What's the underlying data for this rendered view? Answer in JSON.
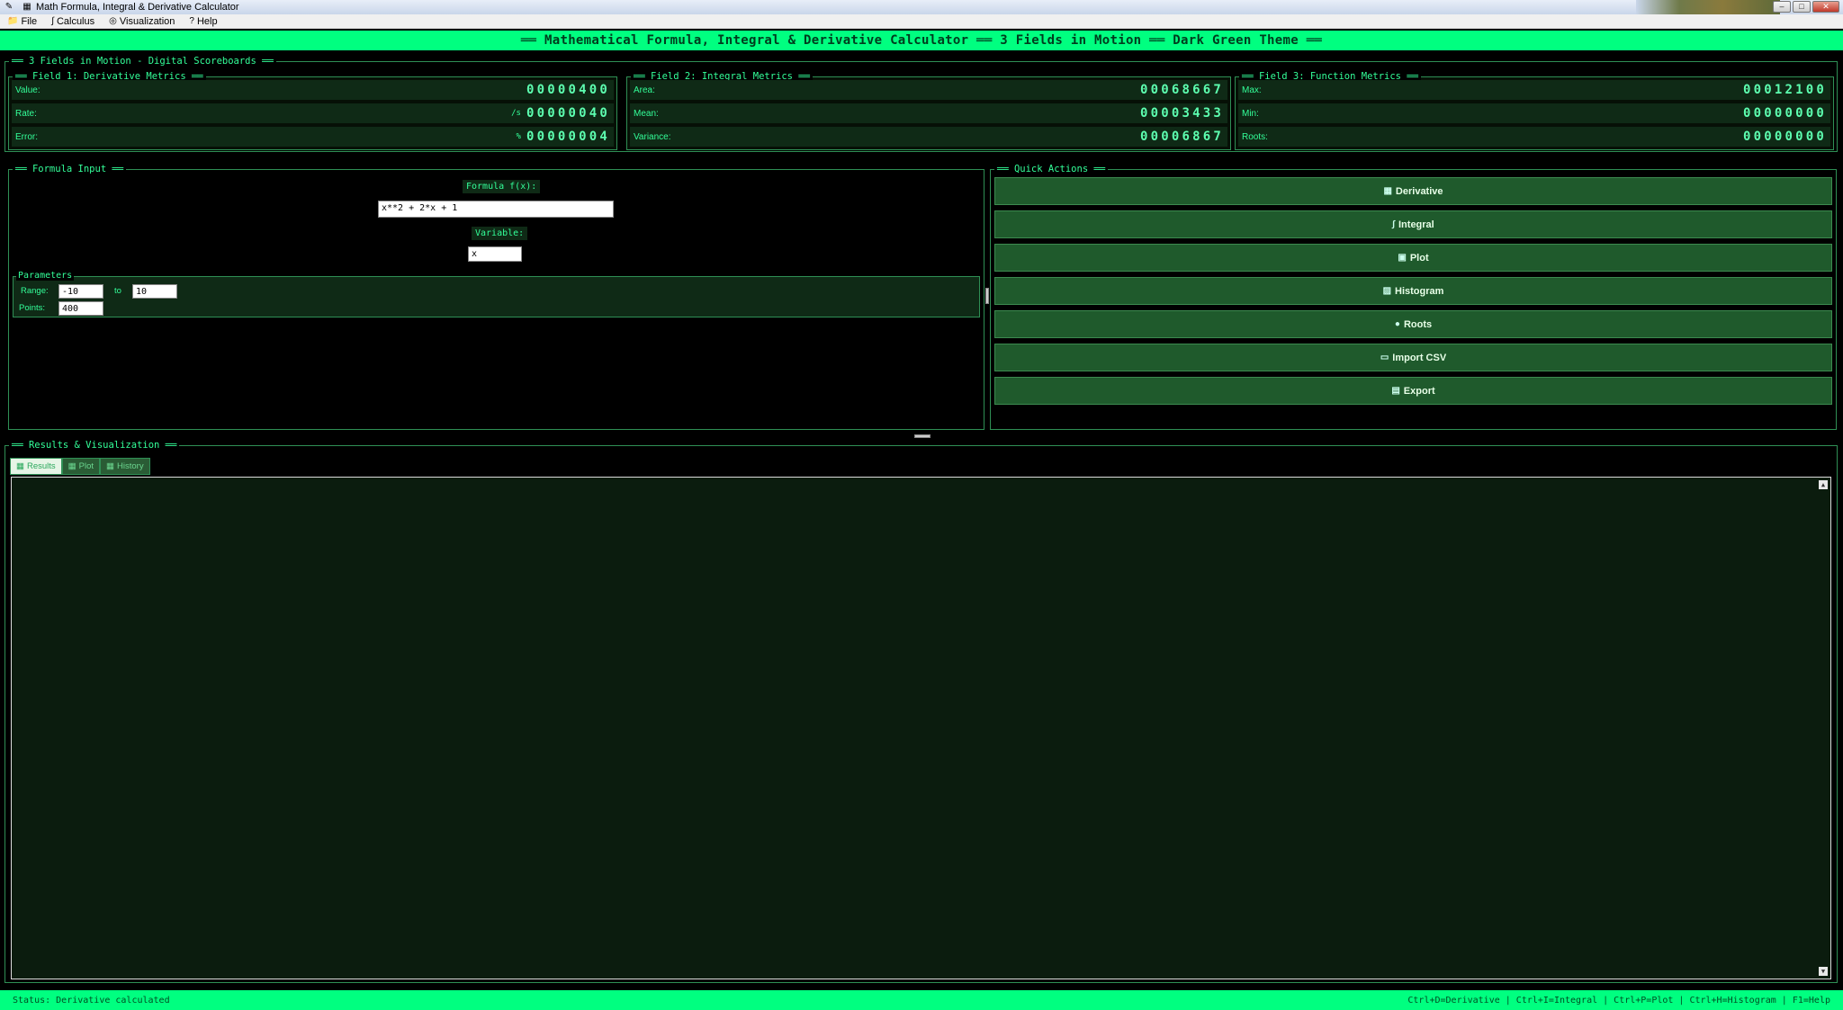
{
  "window": {
    "title": "Math Formula, Integral & Derivative Calculator"
  },
  "menu": [
    {
      "icon": "📁",
      "label": "File"
    },
    {
      "icon": "∫",
      "label": "Calculus"
    },
    {
      "icon": "◎",
      "label": "Visualization"
    },
    {
      "icon": "?",
      "label": "Help"
    }
  ],
  "banner": {
    "text": "══ Mathematical Formula, Integral & Derivative Calculator ══ 3 Fields in Motion ══ Dark Green Theme ══"
  },
  "scoreboards": {
    "title": "══ 3 Fields in Motion - Digital Scoreboards ══",
    "fields": [
      {
        "title": "══ Field 1: Derivative Metrics ══",
        "rows": [
          {
            "label": "Value:",
            "unit": "",
            "digits": "00000400"
          },
          {
            "label": "Rate:",
            "unit": "/s",
            "digits": "00000040"
          },
          {
            "label": "Error:",
            "unit": "%",
            "digits": "00000004"
          }
        ]
      },
      {
        "title": "══ Field 2: Integral Metrics ══",
        "rows": [
          {
            "label": "Area:",
            "unit": "",
            "digits": "00068667"
          },
          {
            "label": "Mean:",
            "unit": "",
            "digits": "00003433"
          },
          {
            "label": "Variance:",
            "unit": "",
            "digits": "00006867"
          }
        ]
      },
      {
        "title": "══ Field 3: Function Metrics ══",
        "rows": [
          {
            "label": "Max:",
            "unit": "",
            "digits": "00012100"
          },
          {
            "label": "Min:",
            "unit": "",
            "digits": "00000000"
          },
          {
            "label": "Roots:",
            "unit": "",
            "digits": "00000000"
          }
        ]
      }
    ]
  },
  "formula": {
    "title": "══ Formula Input ══",
    "formula_label": "Formula f(x):",
    "formula_value": "x**2 + 2*x + 1",
    "variable_label": "Variable:",
    "variable_value": "x",
    "params_label": "Parameters",
    "range_label": "Range:",
    "range_from": "-10",
    "range_to_label": "to",
    "range_to": "10",
    "points_label": "Points:",
    "points_value": "400"
  },
  "quick_actions": {
    "title": "══ Quick Actions ══",
    "buttons": [
      {
        "icon": "▦",
        "label": "Derivative"
      },
      {
        "icon": "∫",
        "label": "Integral"
      },
      {
        "icon": "▣",
        "label": "Plot"
      },
      {
        "icon": "▨",
        "label": "Histogram"
      },
      {
        "icon": "●",
        "label": "Roots"
      },
      {
        "icon": "▭",
        "label": "Import CSV"
      },
      {
        "icon": "▤",
        "label": "Export"
      }
    ]
  },
  "results": {
    "title": "══ Results & Visualization ══",
    "tabs": [
      {
        "icon": "▦",
        "label": "Results"
      },
      {
        "icon": "▦",
        "label": "Plot"
      },
      {
        "icon": "▦",
        "label": "History"
      }
    ]
  },
  "status": {
    "text": "Status: Derivative calculated",
    "shortcuts": "Ctrl+D=Derivative | Ctrl+I=Integral | Ctrl+P=Plot | Ctrl+H=Histogram | F1=Help"
  },
  "colors": {
    "accent": "#00ff80",
    "text": "#33ff99",
    "panel": "#0f2a16",
    "button": "#1f5a2c"
  }
}
